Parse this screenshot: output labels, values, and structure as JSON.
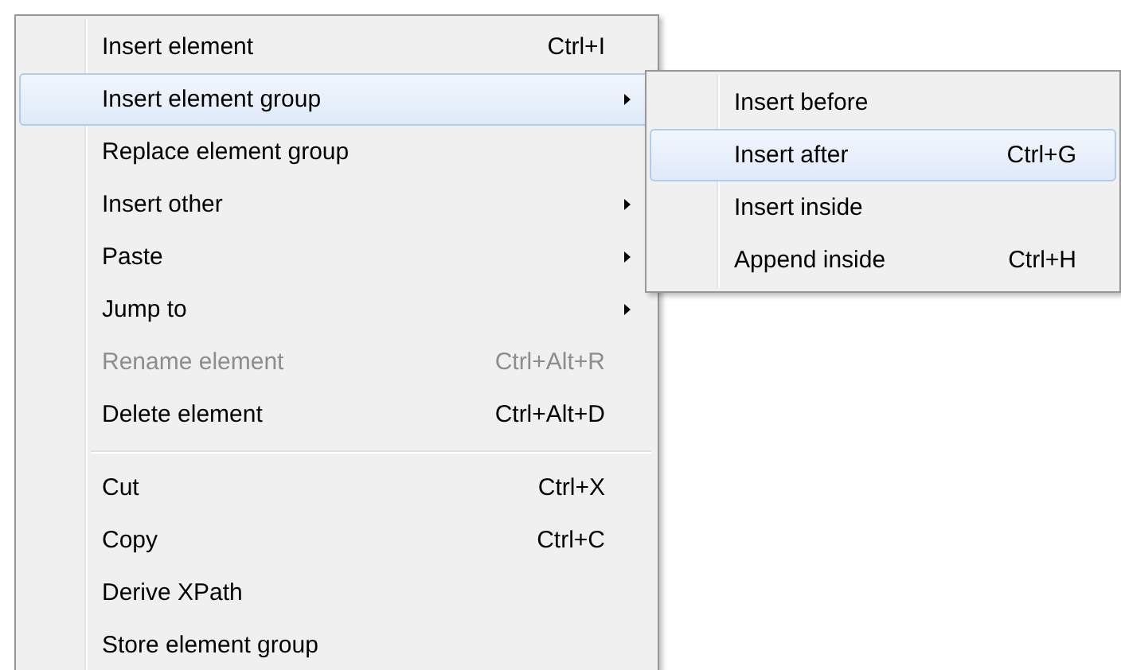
{
  "menu": {
    "items": [
      {
        "kind": "item",
        "label": "Insert element",
        "shortcut": "Ctrl+I",
        "has_submenu": false,
        "disabled": false,
        "selected": false
      },
      {
        "kind": "item",
        "label": "Insert element group",
        "has_submenu": true,
        "disabled": false,
        "selected": true
      },
      {
        "kind": "item",
        "label": "Replace element group",
        "has_submenu": false,
        "disabled": false,
        "selected": false
      },
      {
        "kind": "item",
        "label": "Insert other",
        "has_submenu": true,
        "disabled": false,
        "selected": false
      },
      {
        "kind": "item",
        "label": "Paste",
        "has_submenu": true,
        "disabled": false,
        "selected": false
      },
      {
        "kind": "item",
        "label": "Jump to",
        "has_submenu": true,
        "disabled": false,
        "selected": false
      },
      {
        "kind": "item",
        "label": "Rename element",
        "shortcut": "Ctrl+Alt+R",
        "has_submenu": false,
        "disabled": true,
        "selected": false
      },
      {
        "kind": "item",
        "label": "Delete element",
        "shortcut": "Ctrl+Alt+D",
        "has_submenu": false,
        "disabled": false,
        "selected": false
      },
      {
        "kind": "separator"
      },
      {
        "kind": "item",
        "label": "Cut",
        "shortcut": "Ctrl+X",
        "has_submenu": false,
        "disabled": false,
        "selected": false
      },
      {
        "kind": "item",
        "label": "Copy",
        "shortcut": "Ctrl+C",
        "has_submenu": false,
        "disabled": false,
        "selected": false
      },
      {
        "kind": "item",
        "label": "Derive XPath",
        "has_submenu": false,
        "disabled": false,
        "selected": false
      },
      {
        "kind": "item",
        "label": "Store element group",
        "has_submenu": false,
        "disabled": false,
        "selected": false
      }
    ]
  },
  "submenu": {
    "items": [
      {
        "kind": "item",
        "label": "Insert before",
        "has_submenu": false,
        "disabled": false,
        "selected": false
      },
      {
        "kind": "item",
        "label": "Insert after",
        "shortcut": "Ctrl+G",
        "has_submenu": false,
        "disabled": false,
        "selected": true
      },
      {
        "kind": "item",
        "label": "Insert inside",
        "has_submenu": false,
        "disabled": false,
        "selected": false
      },
      {
        "kind": "item",
        "label": "Append inside",
        "shortcut": "Ctrl+H",
        "has_submenu": false,
        "disabled": false,
        "selected": false
      }
    ]
  }
}
